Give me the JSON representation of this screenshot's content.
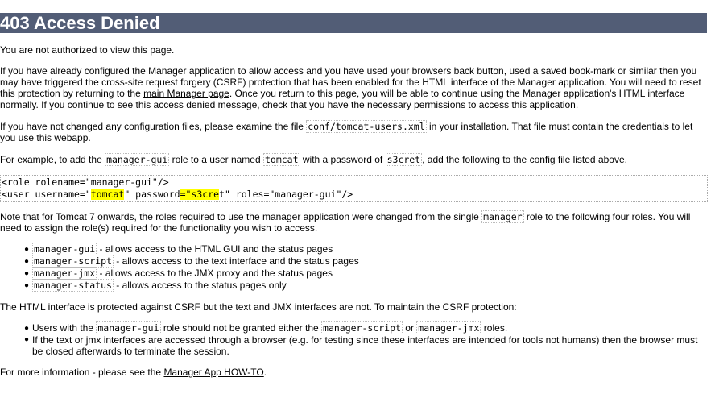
{
  "heading": "403 Access Denied",
  "p1": "You are not authorized to view this page.",
  "p2": {
    "part1": "If you have already configured the Manager application to allow access and you have used your browsers back button, used a saved book-mark or similar then you may have triggered the cross-site request forgery (CSRF) protection that has been enabled for the HTML interface of the Manager application. You will need to reset this protection by returning to the ",
    "link": "main Manager page",
    "part2": ". Once you return to this page, you will be able to continue using the Manager application's HTML interface normally. If you continue to see this access denied message, check that you have the necessary permissions to access this application."
  },
  "p3": {
    "part1": "If you have not changed any configuration files, please examine the file ",
    "code": "conf/tomcat-users.xml",
    "part2": " in your installation. That file must contain the credentials to let you use this webapp."
  },
  "p4": {
    "part1": "For example, to add the ",
    "code1": "manager-gui",
    "part2": " role to a user named ",
    "code2": "tomcat",
    "part3": " with a password of ",
    "code3": "s3cret",
    "part4": ", add the following to the config file listed above."
  },
  "code_block": {
    "line1": "<role rolename=\"manager-gui\"/>",
    "line2_a": "<user username=\"",
    "line2_user": "tomcat",
    "line2_b": "\" password",
    "line2_c": "=",
    "line2_pw": "\"s3cre",
    "line2_d": "t\" roles=\"manager-gui\"/>"
  },
  "p5": {
    "part1": "Note that for Tomcat 7 onwards, the roles required to use the manager application were changed from the single ",
    "code": "manager",
    "part2": " role to the following four roles. You will need to assign the role(s) required for the functionality you wish to access."
  },
  "roles": [
    {
      "code": "manager-gui",
      "desc": " - allows access to the HTML GUI and the status pages"
    },
    {
      "code": "manager-script",
      "desc": " - allows access to the text interface and the status pages"
    },
    {
      "code": "manager-jmx",
      "desc": " - allows access to the JMX proxy and the status pages"
    },
    {
      "code": "manager-status",
      "desc": " - allows access to the status pages only"
    }
  ],
  "p6": "The HTML interface is protected against CSRF but the text and JMX interfaces are not. To maintain the CSRF protection:",
  "csrf_items": {
    "item1": {
      "part1": "Users with the ",
      "code1": "manager-gui",
      "part2": " role should not be granted either the ",
      "code2": "manager-script",
      "part3": " or ",
      "code3": "manager-jmx",
      "part4": " roles."
    },
    "item2": "If the text or jmx interfaces are accessed through a browser (e.g. for testing since these interfaces are intended for tools not humans) then the browser must be closed afterwards to terminate the session."
  },
  "p7": {
    "part1": "For more information - please see the ",
    "link": "Manager App HOW-TO",
    "part2": "."
  }
}
